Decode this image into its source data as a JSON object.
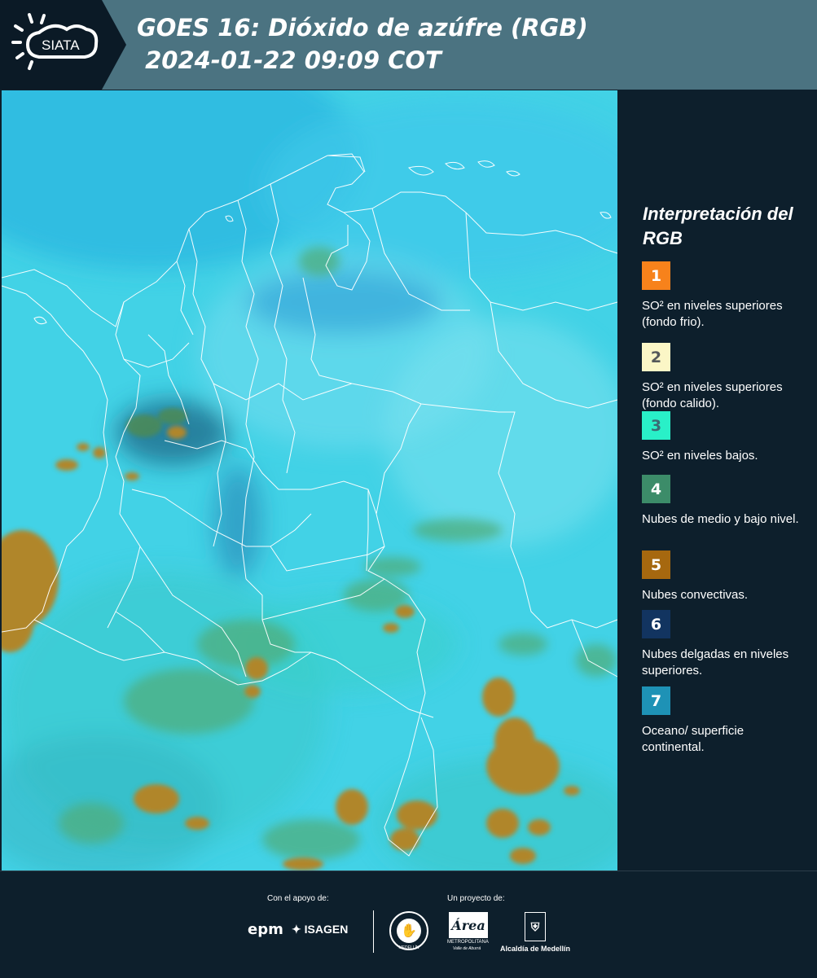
{
  "header": {
    "logo_text": "SIATA",
    "title": "GOES 16: Dióxido de azúfre (RGB)\n 2024-01-22 09:09 COT"
  },
  "legend": {
    "title": "Interpretación del RGB",
    "items": [
      {
        "num": "1",
        "color": "#f7821b",
        "text_color": "#ffffff",
        "label": "SO² en niveles superiores (fondo frio)."
      },
      {
        "num": "2",
        "color": "#fbf6c6",
        "text_color": "#55585a",
        "label": "SO² en niveles superiores (fondo calido)."
      },
      {
        "num": "3",
        "color": "#29f0c8",
        "text_color": "#3b6a74",
        "label": "SO² en niveles bajos."
      },
      {
        "num": "4",
        "color": "#3c8c69",
        "text_color": "#ffffff",
        "label": "Nubes de medio y bajo nivel."
      },
      {
        "num": "5",
        "color": "#a6680f",
        "text_color": "#ffffff",
        "label": "Nubes convectivas."
      },
      {
        "num": "6",
        "color": "#123460",
        "text_color": "#ffffff",
        "label": "Nubes delgadas en niveles superiores."
      },
      {
        "num": "7",
        "color": "#1e92b6",
        "text_color": "#ffffff",
        "label": "Oceano/ superficie continental."
      }
    ]
  },
  "footer": {
    "support_label": "Con el apoyo de:",
    "project_label": "Un proyecto de:",
    "logo_epm": "epm",
    "logo_isagen": "ISAGEN",
    "logo_medellin": "MEDELLÍN",
    "logo_area": "Área",
    "logo_area_sub1": "METROPOLITANA",
    "logo_area_sub2": "Valle de Aburrá",
    "logo_alcaldia": "Alcaldía de Medellín"
  }
}
